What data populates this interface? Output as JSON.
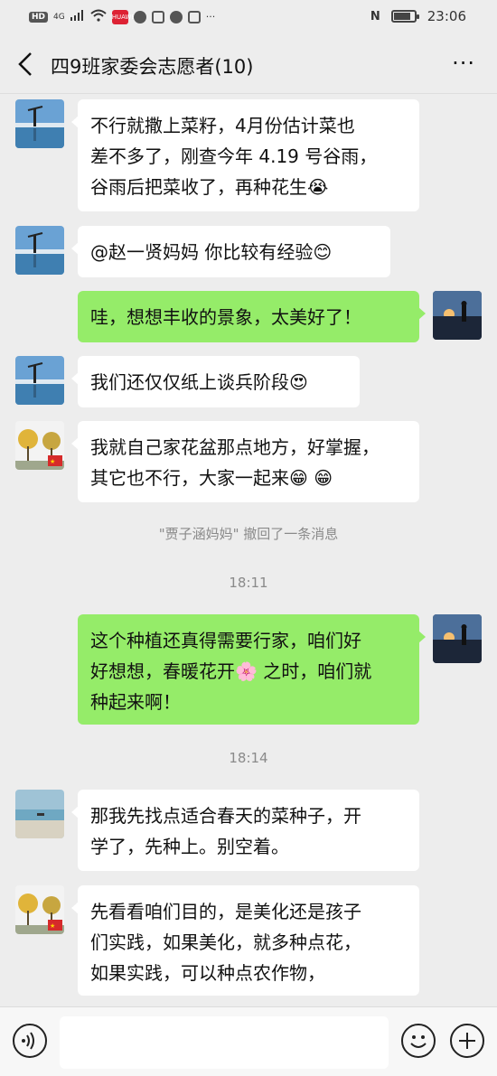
{
  "status_bar": {
    "hd": "HD",
    "signal": "4G",
    "carrier_badge": "HUAWEI",
    "time": "23:06",
    "nfc": "N",
    "battery_level_percent": 85
  },
  "header": {
    "title": "四9班家委会志愿者(10)",
    "more": "···"
  },
  "messages": [
    {
      "side": "left",
      "lines": [
        "不行就撒上菜籽，4月份估计菜也",
        "差不多了，刚查今年 4.19 号谷雨，",
        "谷雨后把菜收了，再种花生😭"
      ]
    },
    {
      "side": "left",
      "lines": [
        "@赵一贤妈妈  你比较有经验😊"
      ]
    },
    {
      "side": "right",
      "lines": [
        "哇，想想丰收的景象，太美好了！"
      ]
    },
    {
      "side": "left",
      "lines": [
        "我们还仅仅纸上谈兵阶段😍"
      ]
    },
    {
      "side": "left",
      "lines": [
        "我就自己家花盆那点地方，好掌握，",
        "其它也不行，大家一起来😁 😁"
      ]
    },
    {
      "side": "right",
      "lines": [
        "这个种植还真得需要行家，咱们好",
        "好想想，春暖花开🌸 之时，咱们就",
        "种起来啊！"
      ]
    },
    {
      "side": "left",
      "lines": [
        "那我先找点适合春天的菜种子，开",
        "学了，先种上。别空着。"
      ]
    },
    {
      "side": "left",
      "lines": [
        "先看看咱们目的，是美化还是孩子",
        "们实践，如果美化，就多种点花，",
        "如果实践，可以种点农作物，"
      ]
    }
  ],
  "system_notice": "\"贾子涵妈妈\" 撤回了一条消息",
  "timestamps": [
    "18:11",
    "18:14"
  ],
  "input": {
    "placeholder": ""
  },
  "colors": {
    "self_bubble": "#95ec69",
    "other_bubble": "#ffffff",
    "background": "#ededed"
  },
  "icons": {
    "back": "back-arrow-icon",
    "voice": "voice-icon",
    "emoji": "emoji-icon",
    "plus": "plus-icon"
  }
}
